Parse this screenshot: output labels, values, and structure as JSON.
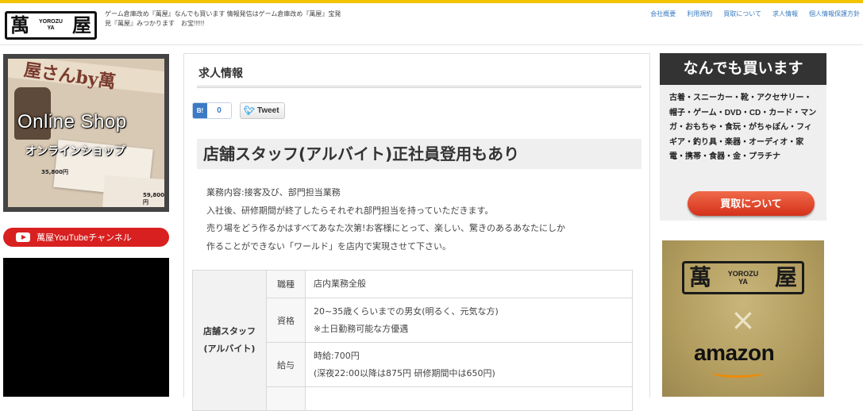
{
  "header": {
    "logo": {
      "kanji_left": "萬",
      "kanji_right": "屋",
      "romaji_line1": "YOROZU",
      "romaji_line2": "YA"
    },
    "tagline": "ゲーム倉庫改め『萬屋』なんでも買います 情報発信はゲーム倉庫改め『萬屋』宝発見『萬屋』みつかります　お宝!!!!!!",
    "nav": [
      "会社概要",
      "利用規約",
      "買取について",
      "求人情報",
      "個人情報保護方針"
    ]
  },
  "sidebar": {
    "shop_banner": {
      "title": "Online Shop",
      "subtitle": "オンラインショップ",
      "bg_text": "屋さんby萬",
      "price_1": "35,800円",
      "price_2": "59,800円"
    },
    "youtube_button": "萬屋YouTubeチャンネル"
  },
  "main": {
    "page_title": "求人情報",
    "share": {
      "hatena_label": "B!",
      "hatena_count": "0",
      "tweet_label": "Tweet"
    },
    "job_heading": "店舗スタッフ(アルバイト)正社員登用もあり",
    "description": [
      "業務内容:接客及び、部門担当業務",
      "入社後、研修期間が終了したらそれぞれ部門担当を持っていただきます。",
      "売り場をどう作るかはすべてあなた次第!お客様にとって、楽しい、驚きのあるあなたにしか",
      "作ることができない「ワールド」を店内で実現させて下さい。"
    ],
    "table": {
      "position_line1": "店舗スタッフ",
      "position_line2": "(アルバイト)",
      "rows": [
        {
          "label": "職種",
          "value_line1": "店内業務全般",
          "value_line2": ""
        },
        {
          "label": "資格",
          "value_line1": "20~35歳くらいまでの男女(明るく、元気な方)",
          "value_line2": "※土日勤務可能な方優遇"
        },
        {
          "label": "給与",
          "value_line1": "時給:700円",
          "value_line2": "(深夜22:00以降は875円 研修期間中は650円)"
        }
      ]
    }
  },
  "right": {
    "buy_ad": {
      "heading": "なんでも買います",
      "text": "古着・スニーカー・靴・アクセサリー・帽子・ゲーム・DVD・CD・カード・マンガ・おもちゃ・食玩・がちゃぽん・フィギア・釣り具・楽器・オーディオ・家電・携帯・食器・金・プラチナ",
      "button": "買取について"
    },
    "amazon_ad": {
      "logo_kanji_left": "萬",
      "logo_kanji_right": "屋",
      "logo_romaji_line1": "YOROZU",
      "logo_romaji_line2": "YA",
      "cross": "×",
      "amazon": "amazon"
    }
  }
}
